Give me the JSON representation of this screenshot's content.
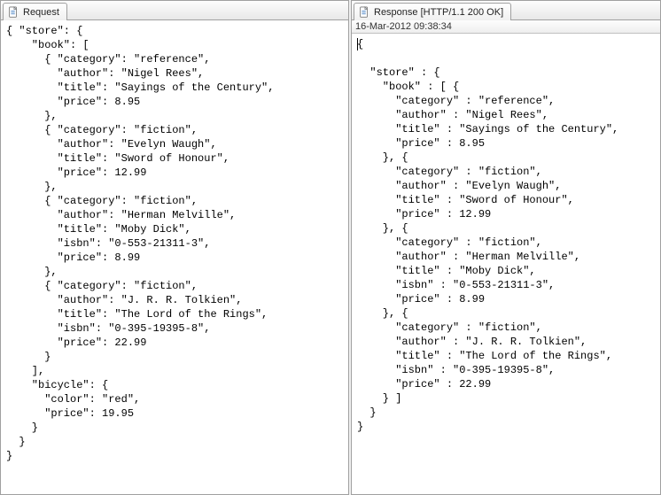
{
  "left": {
    "tab_label": "Request",
    "code": "{ \"store\": {\n    \"book\": [ \n      { \"category\": \"reference\",\n        \"author\": \"Nigel Rees\",\n        \"title\": \"Sayings of the Century\",\n        \"price\": 8.95\n      },\n      { \"category\": \"fiction\",\n        \"author\": \"Evelyn Waugh\",\n        \"title\": \"Sword of Honour\",\n        \"price\": 12.99\n      },\n      { \"category\": \"fiction\",\n        \"author\": \"Herman Melville\",\n        \"title\": \"Moby Dick\",\n        \"isbn\": \"0-553-21311-3\",\n        \"price\": 8.99\n      },\n      { \"category\": \"fiction\",\n        \"author\": \"J. R. R. Tolkien\",\n        \"title\": \"The Lord of the Rings\",\n        \"isbn\": \"0-395-19395-8\",\n        \"price\": 22.99\n      }\n    ],\n    \"bicycle\": {\n      \"color\": \"red\",\n      \"price\": 19.95\n    }\n  }\n}"
  },
  "right": {
    "tab_label": "Response [HTTP/1.1 200 OK]",
    "timestamp": "16-Mar-2012 09:38:34",
    "code_first_char": "{",
    "code_rest": "\n  \"store\" : {\n    \"book\" : [ {\n      \"category\" : \"reference\",\n      \"author\" : \"Nigel Rees\",\n      \"title\" : \"Sayings of the Century\",\n      \"price\" : 8.95\n    }, {\n      \"category\" : \"fiction\",\n      \"author\" : \"Evelyn Waugh\",\n      \"title\" : \"Sword of Honour\",\n      \"price\" : 12.99\n    }, {\n      \"category\" : \"fiction\",\n      \"author\" : \"Herman Melville\",\n      \"title\" : \"Moby Dick\",\n      \"isbn\" : \"0-553-21311-3\",\n      \"price\" : 8.99\n    }, {\n      \"category\" : \"fiction\",\n      \"author\" : \"J. R. R. Tolkien\",\n      \"title\" : \"The Lord of the Rings\",\n      \"isbn\" : \"0-395-19395-8\",\n      \"price\" : 22.99\n    } ]\n  }\n}"
  }
}
